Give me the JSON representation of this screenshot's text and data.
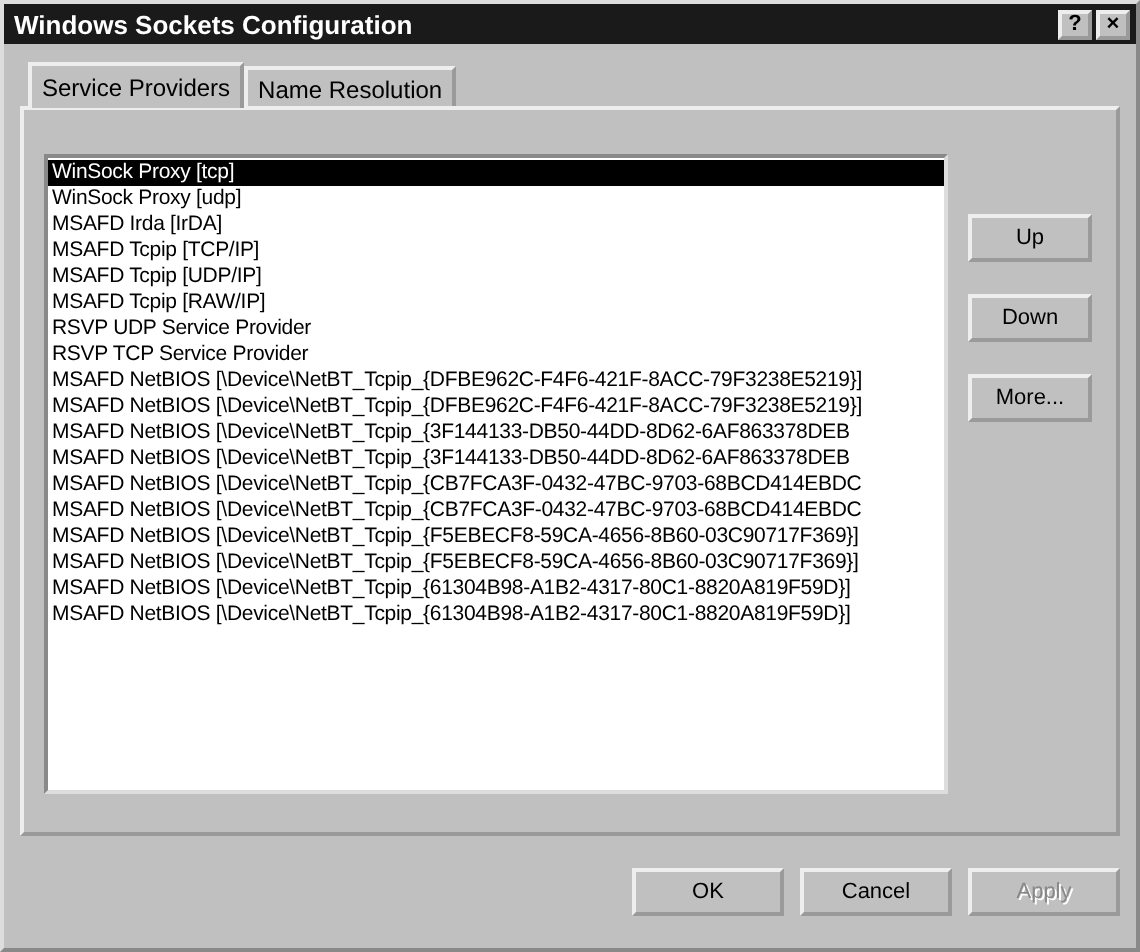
{
  "window": {
    "title": "Windows Sockets Configuration",
    "title_buttons": [
      "?",
      "×"
    ]
  },
  "tabs": [
    {
      "label": "Service Providers",
      "selected": true
    },
    {
      "label": "Name Resolution",
      "selected": false
    }
  ],
  "providers": [
    {
      "label": "WinSock Proxy [tcp]",
      "selected": true
    },
    {
      "label": "WinSock Proxy [udp]",
      "selected": false
    },
    {
      "label": "MSAFD Irda [IrDA]",
      "selected": false
    },
    {
      "label": "MSAFD Tcpip [TCP/IP]",
      "selected": false
    },
    {
      "label": "MSAFD Tcpip [UDP/IP]",
      "selected": false
    },
    {
      "label": "MSAFD Tcpip [RAW/IP]",
      "selected": false
    },
    {
      "label": "RSVP UDP Service Provider",
      "selected": false
    },
    {
      "label": "RSVP TCP Service Provider",
      "selected": false
    },
    {
      "label": "MSAFD NetBIOS [\\Device\\NetBT_Tcpip_{DFBE962C-F4F6-421F-8ACC-79F3238E5219}]",
      "selected": false
    },
    {
      "label": "MSAFD NetBIOS [\\Device\\NetBT_Tcpip_{DFBE962C-F4F6-421F-8ACC-79F3238E5219}]",
      "selected": false
    },
    {
      "label": "MSAFD NetBIOS [\\Device\\NetBT_Tcpip_{3F144133-DB50-44DD-8D62-6AF863378DEB",
      "selected": false
    },
    {
      "label": "MSAFD NetBIOS [\\Device\\NetBT_Tcpip_{3F144133-DB50-44DD-8D62-6AF863378DEB",
      "selected": false
    },
    {
      "label": "MSAFD NetBIOS [\\Device\\NetBT_Tcpip_{CB7FCA3F-0432-47BC-9703-68BCD414EBDC",
      "selected": false
    },
    {
      "label": "MSAFD NetBIOS [\\Device\\NetBT_Tcpip_{CB7FCA3F-0432-47BC-9703-68BCD414EBDC",
      "selected": false
    },
    {
      "label": "MSAFD NetBIOS [\\Device\\NetBT_Tcpip_{F5EBECF8-59CA-4656-8B60-03C90717F369}]",
      "selected": false
    },
    {
      "label": "MSAFD NetBIOS [\\Device\\NetBT_Tcpip_{F5EBECF8-59CA-4656-8B60-03C90717F369}]",
      "selected": false
    },
    {
      "label": "MSAFD NetBIOS [\\Device\\NetBT_Tcpip_{61304B98-A1B2-4317-80C1-8820A819F59D}]",
      "selected": false
    },
    {
      "label": "MSAFD NetBIOS [\\Device\\NetBT_Tcpip_{61304B98-A1B2-4317-80C1-8820A819F59D}]",
      "selected": false
    }
  ],
  "side_buttons": [
    {
      "label": "Up",
      "disabled": false
    },
    {
      "label": "Down",
      "disabled": false
    },
    {
      "label": "More...",
      "disabled": false
    }
  ],
  "buttons": [
    {
      "label": "OK",
      "disabled": false
    },
    {
      "label": "Cancel",
      "disabled": false
    },
    {
      "label": "Apply",
      "disabled": true
    }
  ]
}
